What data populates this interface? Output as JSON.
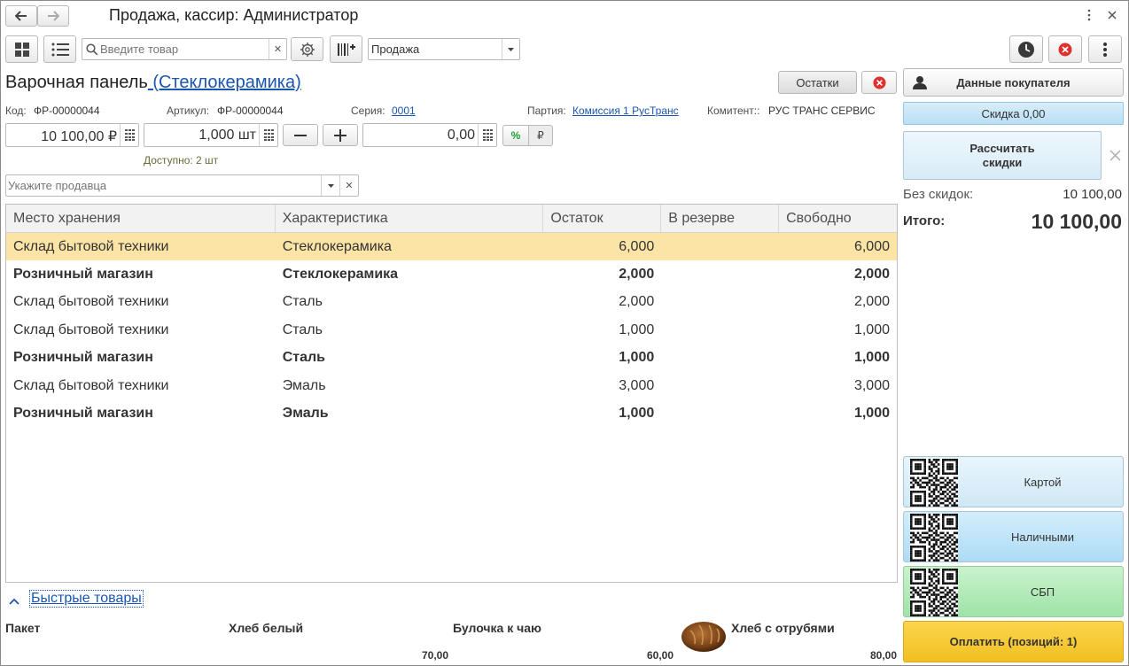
{
  "window": {
    "title": "Продажа, кассир: Администратор"
  },
  "toolbar": {
    "search_placeholder": "Введите товар",
    "mode_value": "Продажа"
  },
  "product": {
    "name": "Варочная панель",
    "variant": " (Стеклокерамика)",
    "stock_button": "Остатки",
    "code_label": "Код:",
    "code_value": "ФР-00000044",
    "article_label": "Артикул:",
    "article_value": "ФР-00000044",
    "series_label": "Серия:",
    "series_value": "0001",
    "batch_label": "Партия:",
    "batch_value": "Комиссия 1  РусТранс",
    "consignor_label": "Комитент::",
    "consignor_value": "РУС ТРАНС СЕРВИС",
    "price": "10 100,00 ₽",
    "quantity": "1,000 шт",
    "discount_value": "0,00",
    "percent_label": "%",
    "ruble_label": "₽",
    "available": "Доступно: 2 шт",
    "seller_placeholder": "Укажите продавца"
  },
  "table": {
    "headers": [
      "Место хранения",
      "Характеристика",
      "Остаток",
      "В резерве",
      "Свободно"
    ],
    "rows": [
      {
        "place": "Склад бытовой техники",
        "characteristic": "Стеклокерамика",
        "balance": "6,000",
        "reserve": "",
        "free": "6,000",
        "bold": false,
        "selected": true
      },
      {
        "place": "Розничный магазин",
        "characteristic": "Стеклокерамика",
        "balance": "2,000",
        "reserve": "",
        "free": "2,000",
        "bold": true,
        "selected": false
      },
      {
        "place": "Склад бытовой техники",
        "characteristic": "Сталь",
        "balance": "2,000",
        "reserve": "",
        "free": "2,000",
        "bold": false,
        "selected": false
      },
      {
        "place": "Склад бытовой техники",
        "characteristic": "Сталь",
        "balance": "1,000",
        "reserve": "",
        "free": "1,000",
        "bold": false,
        "selected": false
      },
      {
        "place": "Розничный магазин",
        "characteristic": "Сталь",
        "balance": "1,000",
        "reserve": "",
        "free": "1,000",
        "bold": true,
        "selected": false
      },
      {
        "place": "Склад бытовой техники",
        "characteristic": "Эмаль",
        "balance": "3,000",
        "reserve": "",
        "free": "3,000",
        "bold": false,
        "selected": false
      },
      {
        "place": "Розничный магазин",
        "characteristic": "Эмаль",
        "balance": "1,000",
        "reserve": "",
        "free": "1,000",
        "bold": true,
        "selected": false
      }
    ]
  },
  "quick": {
    "title": "Быстрые товары",
    "items": [
      {
        "name": "Пакет",
        "price": ""
      },
      {
        "name": "Хлеб белый",
        "price": "70,00"
      },
      {
        "name": "Булочка к чаю",
        "price": "60,00"
      },
      {
        "name": "Хлеб с отрубями",
        "price": "80,00"
      }
    ]
  },
  "side": {
    "customer_button": "Данные покупателя",
    "discount_label": "Скидка 0,00",
    "calc_button_line1": "Рассчитать",
    "calc_button_line2": "скидки",
    "without_discount_label": "Без скидок:",
    "without_discount_value": "10 100,00",
    "total_label": "Итого:",
    "total_value": "10 100,00",
    "pay_card": "Картой",
    "pay_cash": "Наличными",
    "pay_sbp": "СБП",
    "pay_button": "Оплатить (позиций: 1)"
  },
  "colors": {
    "accent_link": "#1a56b0",
    "selected_row": "#fce4a6",
    "card_button": "#d6ecf7",
    "cash_button": "#bfe3f6",
    "sbp_button": "#b6ecbc",
    "pay_button": "#f7c932",
    "close_red": "#e0302e"
  }
}
